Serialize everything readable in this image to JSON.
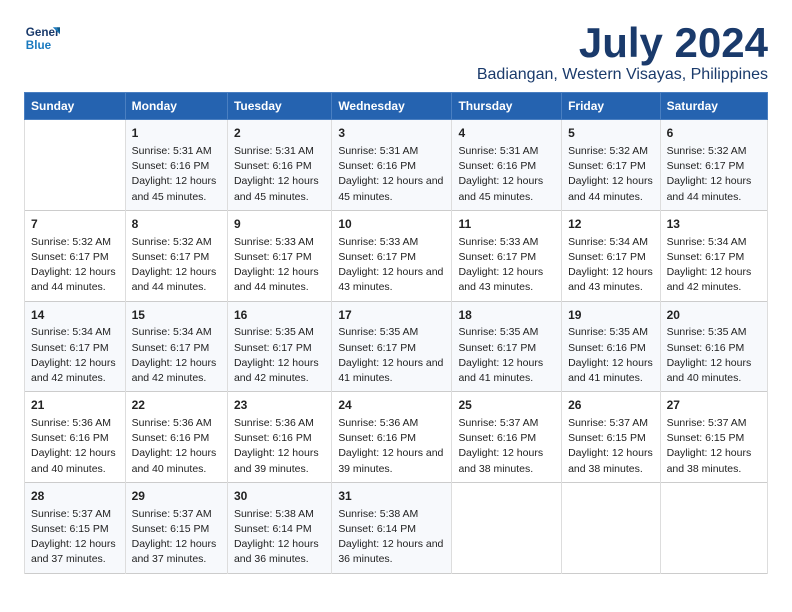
{
  "header": {
    "logo_line1": "General",
    "logo_line2": "Blue",
    "title": "July 2024",
    "subtitle": "Badiangan, Western Visayas, Philippines"
  },
  "calendar": {
    "days_of_week": [
      "Sunday",
      "Monday",
      "Tuesday",
      "Wednesday",
      "Thursday",
      "Friday",
      "Saturday"
    ],
    "weeks": [
      [
        {
          "date": "",
          "content": ""
        },
        {
          "date": "1",
          "content": "Sunrise: 5:31 AM\nSunset: 6:16 PM\nDaylight: 12 hours\nand 45 minutes."
        },
        {
          "date": "2",
          "content": "Sunrise: 5:31 AM\nSunset: 6:16 PM\nDaylight: 12 hours\nand 45 minutes."
        },
        {
          "date": "3",
          "content": "Sunrise: 5:31 AM\nSunset: 6:16 PM\nDaylight: 12 hours\nand 45 minutes."
        },
        {
          "date": "4",
          "content": "Sunrise: 5:31 AM\nSunset: 6:16 PM\nDaylight: 12 hours\nand 45 minutes."
        },
        {
          "date": "5",
          "content": "Sunrise: 5:32 AM\nSunset: 6:17 PM\nDaylight: 12 hours\nand 44 minutes."
        },
        {
          "date": "6",
          "content": "Sunrise: 5:32 AM\nSunset: 6:17 PM\nDaylight: 12 hours\nand 44 minutes."
        }
      ],
      [
        {
          "date": "7",
          "content": "Sunrise: 5:32 AM\nSunset: 6:17 PM\nDaylight: 12 hours\nand 44 minutes."
        },
        {
          "date": "8",
          "content": "Sunrise: 5:32 AM\nSunset: 6:17 PM\nDaylight: 12 hours\nand 44 minutes."
        },
        {
          "date": "9",
          "content": "Sunrise: 5:33 AM\nSunset: 6:17 PM\nDaylight: 12 hours\nand 44 minutes."
        },
        {
          "date": "10",
          "content": "Sunrise: 5:33 AM\nSunset: 6:17 PM\nDaylight: 12 hours\nand 43 minutes."
        },
        {
          "date": "11",
          "content": "Sunrise: 5:33 AM\nSunset: 6:17 PM\nDaylight: 12 hours\nand 43 minutes."
        },
        {
          "date": "12",
          "content": "Sunrise: 5:34 AM\nSunset: 6:17 PM\nDaylight: 12 hours\nand 43 minutes."
        },
        {
          "date": "13",
          "content": "Sunrise: 5:34 AM\nSunset: 6:17 PM\nDaylight: 12 hours\nand 42 minutes."
        }
      ],
      [
        {
          "date": "14",
          "content": "Sunrise: 5:34 AM\nSunset: 6:17 PM\nDaylight: 12 hours\nand 42 minutes."
        },
        {
          "date": "15",
          "content": "Sunrise: 5:34 AM\nSunset: 6:17 PM\nDaylight: 12 hours\nand 42 minutes."
        },
        {
          "date": "16",
          "content": "Sunrise: 5:35 AM\nSunset: 6:17 PM\nDaylight: 12 hours\nand 42 minutes."
        },
        {
          "date": "17",
          "content": "Sunrise: 5:35 AM\nSunset: 6:17 PM\nDaylight: 12 hours\nand 41 minutes."
        },
        {
          "date": "18",
          "content": "Sunrise: 5:35 AM\nSunset: 6:17 PM\nDaylight: 12 hours\nand 41 minutes."
        },
        {
          "date": "19",
          "content": "Sunrise: 5:35 AM\nSunset: 6:16 PM\nDaylight: 12 hours\nand 41 minutes."
        },
        {
          "date": "20",
          "content": "Sunrise: 5:35 AM\nSunset: 6:16 PM\nDaylight: 12 hours\nand 40 minutes."
        }
      ],
      [
        {
          "date": "21",
          "content": "Sunrise: 5:36 AM\nSunset: 6:16 PM\nDaylight: 12 hours\nand 40 minutes."
        },
        {
          "date": "22",
          "content": "Sunrise: 5:36 AM\nSunset: 6:16 PM\nDaylight: 12 hours\nand 40 minutes."
        },
        {
          "date": "23",
          "content": "Sunrise: 5:36 AM\nSunset: 6:16 PM\nDaylight: 12 hours\nand 39 minutes."
        },
        {
          "date": "24",
          "content": "Sunrise: 5:36 AM\nSunset: 6:16 PM\nDaylight: 12 hours\nand 39 minutes."
        },
        {
          "date": "25",
          "content": "Sunrise: 5:37 AM\nSunset: 6:16 PM\nDaylight: 12 hours\nand 38 minutes."
        },
        {
          "date": "26",
          "content": "Sunrise: 5:37 AM\nSunset: 6:15 PM\nDaylight: 12 hours\nand 38 minutes."
        },
        {
          "date": "27",
          "content": "Sunrise: 5:37 AM\nSunset: 6:15 PM\nDaylight: 12 hours\nand 38 minutes."
        }
      ],
      [
        {
          "date": "28",
          "content": "Sunrise: 5:37 AM\nSunset: 6:15 PM\nDaylight: 12 hours\nand 37 minutes."
        },
        {
          "date": "29",
          "content": "Sunrise: 5:37 AM\nSunset: 6:15 PM\nDaylight: 12 hours\nand 37 minutes."
        },
        {
          "date": "30",
          "content": "Sunrise: 5:38 AM\nSunset: 6:14 PM\nDaylight: 12 hours\nand 36 minutes."
        },
        {
          "date": "31",
          "content": "Sunrise: 5:38 AM\nSunset: 6:14 PM\nDaylight: 12 hours\nand 36 minutes."
        },
        {
          "date": "",
          "content": ""
        },
        {
          "date": "",
          "content": ""
        },
        {
          "date": "",
          "content": ""
        }
      ]
    ]
  }
}
